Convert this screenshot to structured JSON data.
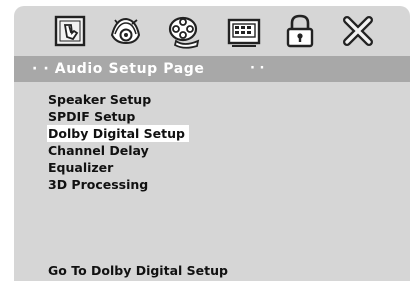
{
  "toolbar": {
    "icons": [
      "general-setup-icon",
      "audio-setup-icon",
      "video-setup-icon",
      "preference-icon",
      "password-icon",
      "exit-icon"
    ]
  },
  "title_bar": {
    "title": "· · Audio Setup Page",
    "trailing_dots": "· ·"
  },
  "menu": {
    "items": [
      {
        "label": "Speaker Setup"
      },
      {
        "label": "SPDIF Setup"
      },
      {
        "label": "Dolby Digital Setup",
        "selected": true
      },
      {
        "label": "Channel Delay"
      },
      {
        "label": "Equalizer"
      },
      {
        "label": "3D Processing"
      }
    ]
  },
  "status": {
    "text": "Go To Dolby Digital Setup"
  }
}
